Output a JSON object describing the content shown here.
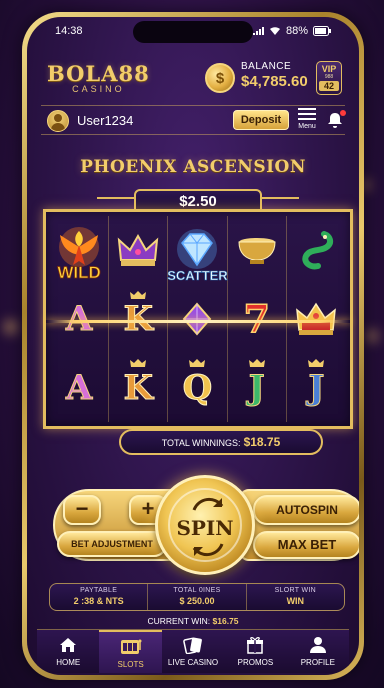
{
  "status_bar": {
    "time": "14:38",
    "battery": "88%"
  },
  "header": {
    "brand": "BOLA88",
    "brand_sub": "CASINO",
    "coin_symbol": "$",
    "balance_label": "BALANCE",
    "balance_value": "$4,785.60",
    "vip_label": "VIP",
    "vip_sub": "988",
    "vip_level": "42"
  },
  "userbar": {
    "username": "User1234",
    "deposit_label": "Deposit",
    "menu_label": "Menu"
  },
  "game": {
    "title": "PHOENIX ASCENSION",
    "bet": "$2.50",
    "reels": [
      {
        "symbol": "phoenix-icon",
        "tag": "WILD"
      },
      {
        "symbol": "purple-crown-icon",
        "tag": ""
      },
      {
        "symbol": "diamond-icon",
        "tag": "SCATTER"
      },
      {
        "symbol": "gold-bowl-icon",
        "tag": ""
      },
      {
        "symbol": "jade-dragon-icon",
        "tag": ""
      },
      {
        "symbol": "A",
        "tag": ""
      },
      {
        "symbol": "K",
        "tag": ""
      },
      {
        "symbol": "purple-gem-icon",
        "tag": ""
      },
      {
        "symbol": "7",
        "tag": ""
      },
      {
        "symbol": "red-crown-icon",
        "tag": ""
      },
      {
        "symbol": "A",
        "tag": ""
      },
      {
        "symbol": "K",
        "tag": ""
      },
      {
        "symbol": "Q",
        "tag": ""
      },
      {
        "symbol": "J",
        "tag": ""
      },
      {
        "symbol": "J",
        "tag": ""
      }
    ],
    "winnings_label": "TOTAL WINNINGS:",
    "winnings_value": "$18.75"
  },
  "controls": {
    "minus": "−",
    "plus": "+",
    "bet_adjustment": "BET ADJUSTMENT",
    "spin": "SPIN",
    "autospin": "AUTOSPIN",
    "max_bet": "MAX BET"
  },
  "stats": [
    {
      "label": "PAYTABLE",
      "value": "2 :38 & NTS"
    },
    {
      "label": "TOTAL 0INES",
      "value": "$ 250.00"
    },
    {
      "label": "SLORT WIN",
      "value": "WIN"
    }
  ],
  "current_win": {
    "label": "CURRENT WIN:",
    "value": "$16.75"
  },
  "nav": [
    {
      "label": "HOME",
      "icon": "home-icon"
    },
    {
      "label": "SLOTS",
      "icon": "slots-icon",
      "active": true
    },
    {
      "label": "LIVE CASINO",
      "icon": "cards-icon"
    },
    {
      "label": "PROMOS",
      "icon": "gift-icon"
    },
    {
      "label": "PROFILE",
      "icon": "profile-icon"
    }
  ],
  "colors": {
    "gold": "#e3bd5f",
    "gold_text": "#f2cd6b",
    "bg": "#2b1346"
  }
}
